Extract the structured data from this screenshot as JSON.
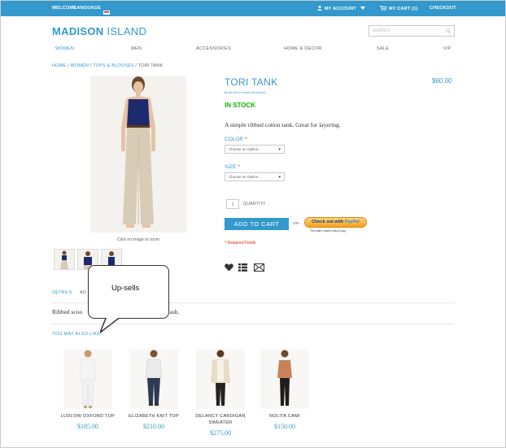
{
  "topbar": {
    "welcome": "WELCOME",
    "language": "LANGUAGE",
    "my_account": "MY ACCOUNT",
    "my_cart": "MY CART (1)",
    "checkout": "CHECKOUT"
  },
  "header": {
    "logo_bold": "MADISON",
    "logo_light": " ISLAND",
    "search_placeholder": "SEARCH"
  },
  "nav": [
    "WOMEN",
    "MEN",
    "ACCESSORIES",
    "HOME & DECOR",
    "SALE",
    "VIP"
  ],
  "breadcrumb": {
    "home": "HOME",
    "women": "WOMEN",
    "category": "TOPS & BLOUSES",
    "current": "TORI TANK",
    "sep": " / "
  },
  "product": {
    "name": "TORI TANK",
    "review_link": "Be the first to review this product",
    "price": "$60.00",
    "stock": "IN STOCK",
    "description": "A simple ribbed cotton tank. Great for layering.",
    "color_label": "COLOR",
    "size_label": "SIZE",
    "required_mark": "*",
    "select_placeholder": "Choose an Option...",
    "qty_value": "1",
    "qty_label": "QUANTITY",
    "add_to_cart": "ADD TO CART",
    "or": "-OR-",
    "paypal_label_a": "Check out with ",
    "paypal_label_b": "PayPal",
    "paypal_sub": "The safer, easier way to pay",
    "required_note": "* Required Fields",
    "zoom_note": "Click on image to zoom"
  },
  "tabs": {
    "details": "DETAILS",
    "second": "AD",
    "content_left": "Ribbed scoo",
    "content_right": "s wash."
  },
  "callout": {
    "text": "Up-sells"
  },
  "upsells": {
    "title": "YOU MAY ALSO LIKE",
    "items": [
      {
        "name": "LUDLOW OXFORD TOP",
        "price": "$185.00"
      },
      {
        "name": "ELIZABETH KNIT TOP",
        "price": "$210.00"
      },
      {
        "name": "DELANCY CARDIGAN SWEATER",
        "price": "$275.00"
      },
      {
        "name": "NOLITA CAMI",
        "price": "$150.00"
      }
    ]
  },
  "colors": {
    "brand_blue": "#3399cc",
    "stock_green": "#11b400",
    "required_red": "#df280a"
  },
  "icons": [
    "flag-icon",
    "account-icon",
    "dropdown-icon",
    "cart-icon",
    "search-icon",
    "heart-icon",
    "compare-icon",
    "email-icon"
  ]
}
